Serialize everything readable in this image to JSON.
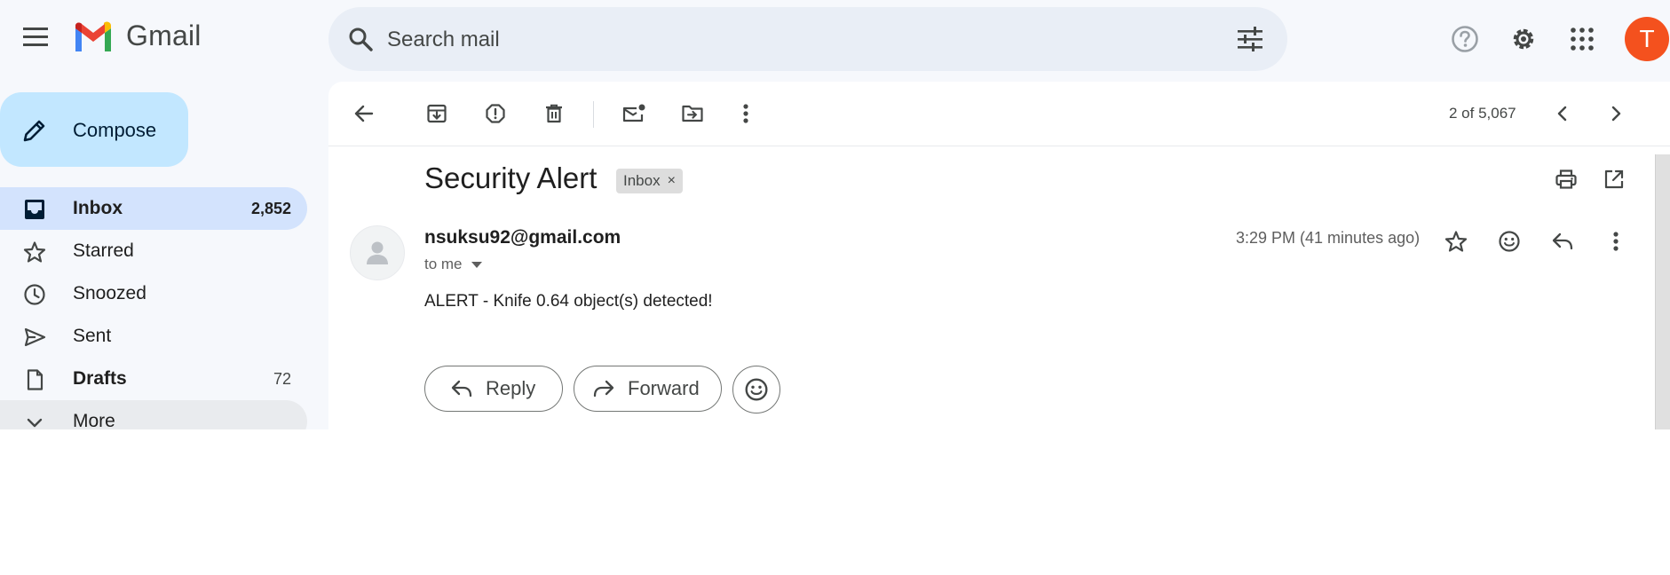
{
  "app": {
    "name": "Gmail"
  },
  "search": {
    "placeholder": "Search mail"
  },
  "account": {
    "initial": "T",
    "color": "#f4511e"
  },
  "sidebar": {
    "compose_label": "Compose",
    "items": [
      {
        "label": "Inbox",
        "count": "2,852",
        "icon": "inbox-icon",
        "active": true
      },
      {
        "label": "Starred",
        "count": "",
        "icon": "star-icon"
      },
      {
        "label": "Snoozed",
        "count": "",
        "icon": "clock-icon"
      },
      {
        "label": "Sent",
        "count": "",
        "icon": "send-icon"
      },
      {
        "label": "Drafts",
        "count": "72",
        "icon": "draft-icon"
      },
      {
        "label": "More",
        "count": "",
        "icon": "chevron-down-icon"
      }
    ]
  },
  "toolbar": {
    "pager": "2 of 5,067",
    "icons": [
      "back-icon",
      "archive-icon",
      "report-spam-icon",
      "delete-icon",
      "mark-unread-icon",
      "move-to-icon",
      "more-vert-icon",
      "prev-icon",
      "next-icon"
    ]
  },
  "email": {
    "subject": "Security Alert",
    "label": "Inbox",
    "label_remove": "×",
    "sender": "nsuksu92@gmail.com",
    "recipient": "to me",
    "time": "3:29 PM (41 minutes ago)",
    "body": "ALERT - Knife 0.64 object(s) detected!"
  },
  "actions": {
    "reply_label": "Reply",
    "forward_label": "Forward"
  },
  "colors": {
    "accent": "#c2e7ff",
    "active_nav": "#d3e3fd",
    "background": "#f6f8fc",
    "search_bg": "#e9eef6"
  }
}
